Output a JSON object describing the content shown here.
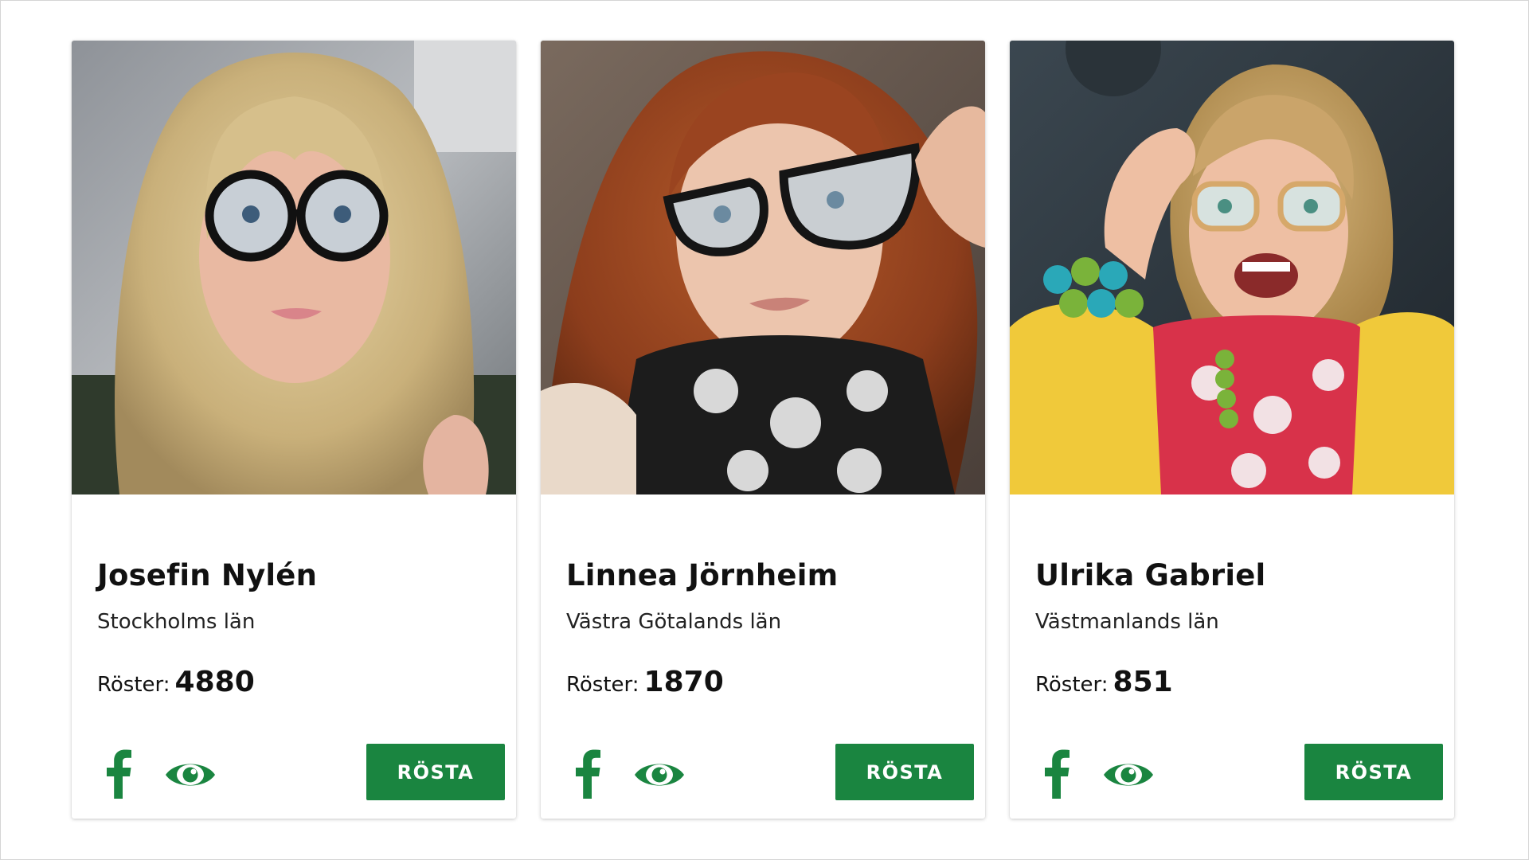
{
  "colors": {
    "accent": "#1a8540",
    "icon": "#1a8540"
  },
  "candidates": [
    {
      "name": "Josefin Nylén",
      "region": "Stockholms län",
      "votes_label": "Röster:",
      "votes": "4880",
      "vote_button": "RÖSTA",
      "photo_icon": "portrait-photo",
      "share_icon": "facebook-icon",
      "view_icon": "eye-icon"
    },
    {
      "name": "Linnea Jörnheim",
      "region": "Västra Götalands län",
      "votes_label": "Röster:",
      "votes": "1870",
      "vote_button": "RÖSTA",
      "photo_icon": "portrait-photo",
      "share_icon": "facebook-icon",
      "view_icon": "eye-icon"
    },
    {
      "name": "Ulrika Gabriel",
      "region": "Västmanlands län",
      "votes_label": "Röster:",
      "votes": "851",
      "vote_button": "RÖSTA",
      "photo_icon": "portrait-photo",
      "share_icon": "facebook-icon",
      "view_icon": "eye-icon"
    }
  ]
}
